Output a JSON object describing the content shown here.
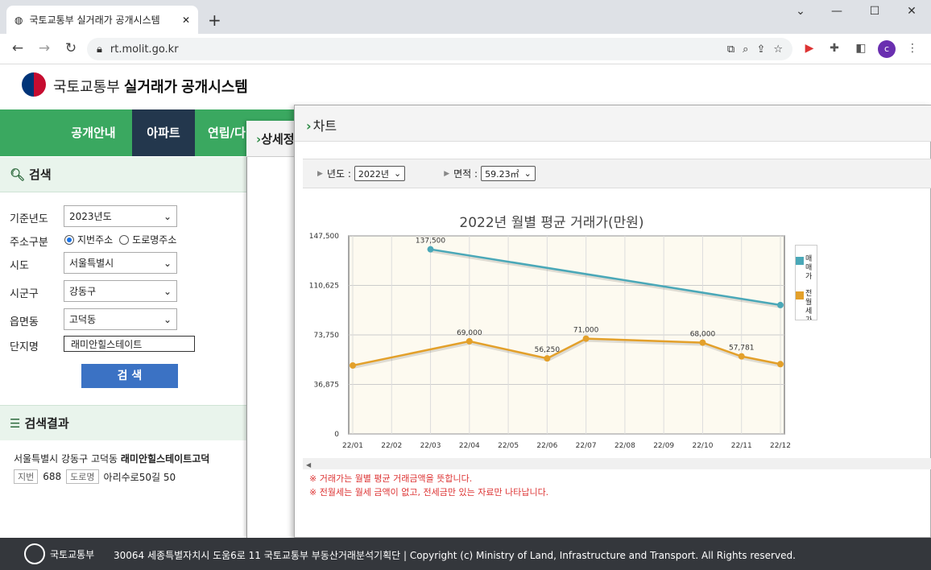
{
  "browser": {
    "tab_title": "국토교통부 실거래가 공개시스템",
    "url": "rt.molit.go.kr",
    "profile_initial": "c"
  },
  "site": {
    "org": "국토교통부",
    "title": "실거래가 공개시스템",
    "nav": [
      "공개안내",
      "아파트",
      "연립/다"
    ]
  },
  "search": {
    "heading": "검색",
    "year_label": "기준년도",
    "year_value": "2023년도",
    "addr_label": "주소구분",
    "addr_opt1": "지번주소",
    "addr_opt2": "도로명주소",
    "sido_label": "시도",
    "sido_value": "서울특별시",
    "sigungu_label": "시군구",
    "sigungu_value": "강동구",
    "dong_label": "읍면동",
    "dong_value": "고덕동",
    "complex_label": "단지명",
    "complex_value": "래미안힐스테이트",
    "button": "검 색"
  },
  "results": {
    "heading": "검색결과",
    "line1_prefix": "서울특별시 강동구 고덕동 ",
    "line1_name": "래미안힐스테이트고덕",
    "jibun_tag": "지번",
    "jibun_value": "688",
    "road_tag": "도로명",
    "road_value": "아리수로50길 50"
  },
  "detail": {
    "heading": "상세정"
  },
  "chart_panel": {
    "heading": "차트",
    "year_label": "년도 :",
    "year_value": "2022년",
    "area_label": "면적 :",
    "area_value": "59.23㎡",
    "legend_a": "매매가",
    "legend_b": "전월세가",
    "note1": "※ 거래가는 월별 평균 거래금액을 뜻합니다.",
    "note2": "※ 전월세는 월세 금액이 없고, 전세금만 있는 자료만 나타납니다."
  },
  "chart_data": {
    "type": "line",
    "title": "2022년 월별 평균 거래가(만원)",
    "categories": [
      "22/01",
      "22/02",
      "22/03",
      "22/04",
      "22/05",
      "22/06",
      "22/07",
      "22/08",
      "22/09",
      "22/10",
      "22/11",
      "22/12"
    ],
    "yticks": [
      "0",
      "36,875",
      "73,750",
      "110,625",
      "147,500"
    ],
    "ylim": [
      0,
      147500
    ],
    "grid": true,
    "legend_position": "right",
    "series": [
      {
        "name": "매매가",
        "color": "#4aa8b8",
        "values": [
          null,
          null,
          137500,
          null,
          null,
          null,
          null,
          null,
          null,
          null,
          null,
          96000
        ],
        "labels": [
          null,
          null,
          "137,500",
          null,
          null,
          null,
          null,
          null,
          null,
          null,
          null,
          null
        ]
      },
      {
        "name": "전월세가",
        "color": "#e3a02a",
        "values": [
          51000,
          null,
          null,
          69000,
          null,
          56250,
          71000,
          null,
          null,
          68000,
          57781,
          52000
        ],
        "labels": [
          null,
          null,
          null,
          "69,000",
          null,
          "56,250",
          "71,000",
          null,
          null,
          "68,000",
          "57,781",
          null
        ]
      }
    ]
  },
  "footer": {
    "org": "국토교통부",
    "address": "30064 세종특별자치시 도움6로 11 국토교통부 부동산거래분석기획단  |  Copyright (c) Ministry of Land, Infrastructure and Transport. All Rights reserved."
  }
}
